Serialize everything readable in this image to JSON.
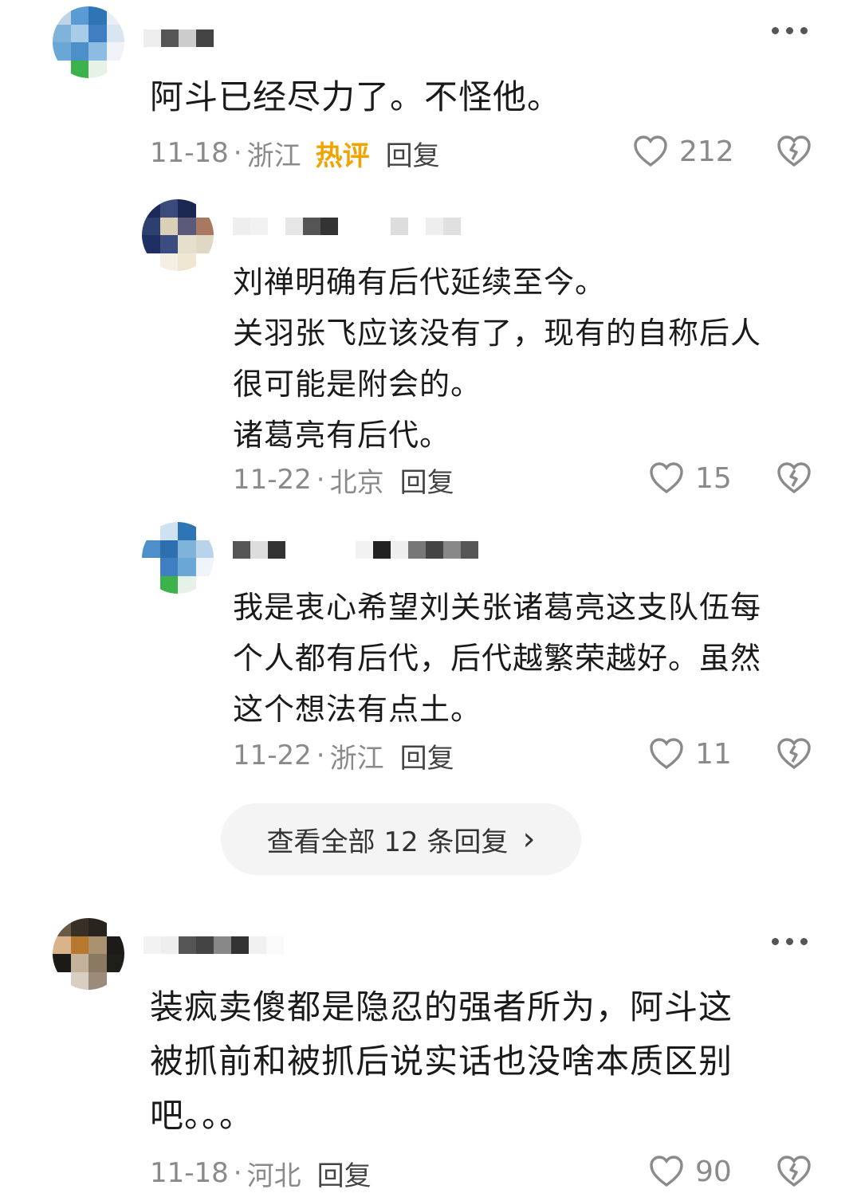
{
  "comments": [
    {
      "text": "阿斗已经尽力了。不怪他。",
      "date": "11-18",
      "location": "浙江",
      "hot_label": "热评",
      "reply_label": "回复",
      "likes": "212",
      "more_icon": "more-dots-icon"
    },
    {
      "text_lines": [
        "装疯卖傻都是隐忍的强者所为，阿斗这",
        "被抓前和被抓后说实话也没啥本质区别",
        "吧。。。"
      ],
      "date": "11-18",
      "location": "河北",
      "reply_label": "回复",
      "likes": "90",
      "more_icon": "more-dots-icon"
    }
  ],
  "replies": [
    {
      "text_lines": [
        "刘禅明确有后代延续至今。",
        "关羽张飞应该没有了，现有的自称后人",
        "很可能是附会的。",
        "诸葛亮有后代。"
      ],
      "date": "11-22",
      "location": "北京",
      "reply_label": "回复",
      "likes": "15"
    },
    {
      "text_lines": [
        "我是衷心希望刘关张诸葛亮这支队伍每",
        "个人都有后代，后代越繁荣越好。虽然",
        "这个想法有点土。"
      ],
      "date": "11-22",
      "location": "浙江",
      "reply_label": "回复",
      "likes": "11"
    }
  ],
  "view_all_replies": {
    "label": "查看全部 12 条回复",
    "arrow": "›"
  },
  "colors": {
    "hot": "#f0a400",
    "meta": "#8a8a8a",
    "pill_bg": "#f4f4f4"
  },
  "icons": {
    "like": "heart-outline-icon",
    "dislike": "broken-heart-icon",
    "more": "more-dots-icon",
    "arrow": "chevron-right-icon"
  }
}
